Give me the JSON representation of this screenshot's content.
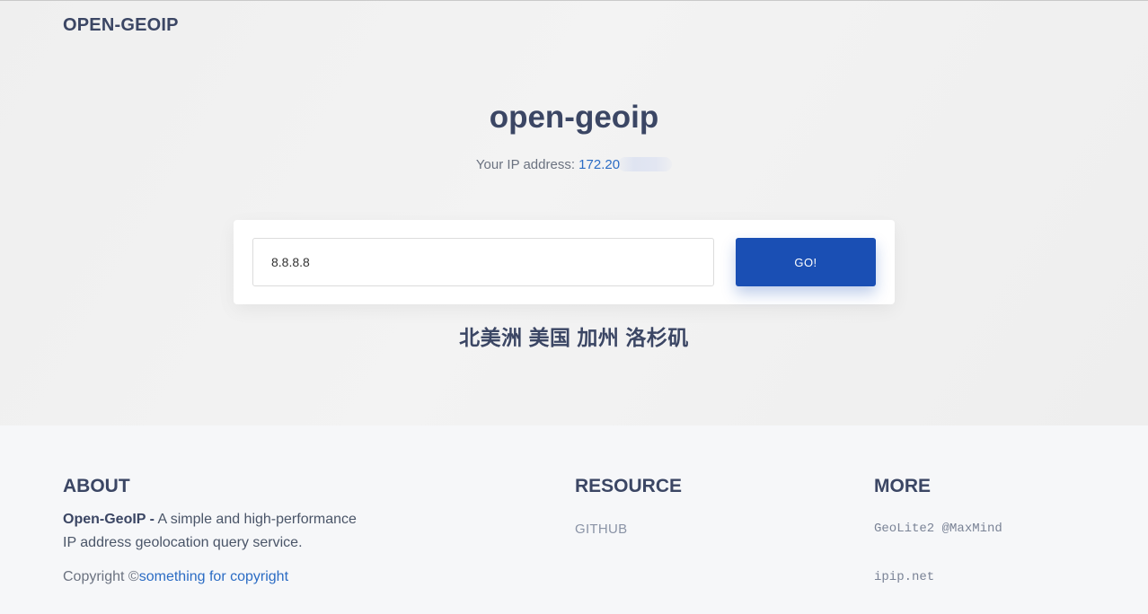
{
  "header": {
    "brand": "OPEN-GEOIP"
  },
  "hero": {
    "title": "open-geoip",
    "ip_label": "Your IP address: ",
    "ip_value": "172.20"
  },
  "search": {
    "input_value": "8.8.8.8",
    "button_label": "GO!"
  },
  "result": {
    "location": "北美洲 美国 加州 洛杉矶"
  },
  "footer": {
    "about": {
      "heading": "ABOUT",
      "name": "Open-GeoIP -",
      "description_line1": " A simple and high-performance",
      "description_line2": "IP address geolocation query service.",
      "copyright_prefix": "Copyright ©",
      "copyright_link": "something for copyright"
    },
    "resource": {
      "heading": "RESOURCE",
      "links": [
        "GITHUB"
      ]
    },
    "more": {
      "heading": "MORE",
      "links": [
        "GeoLite2 @MaxMind",
        "ipip.net"
      ]
    }
  },
  "colors": {
    "accent": "#1a4fb4",
    "link": "#2b6cc4",
    "text": "#3b4664"
  }
}
